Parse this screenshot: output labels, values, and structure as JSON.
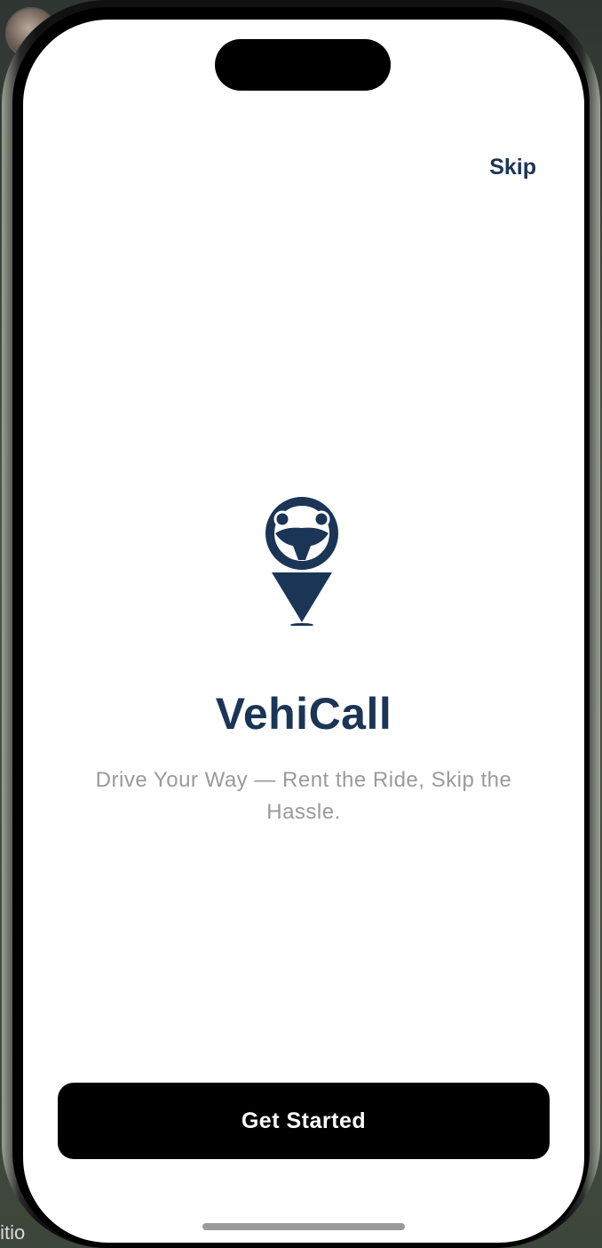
{
  "app": {
    "name": "VehiCall",
    "tagline": "Drive Your Way — Rent the Ride, Skip the Hassle."
  },
  "header": {
    "skip_label": "Skip"
  },
  "footer": {
    "cta_label": "Get Started"
  },
  "background": {
    "partial_label": "ıitio"
  },
  "colors": {
    "brand_navy": "#1b3556",
    "tagline_gray": "#9a9a9a",
    "cta_background": "#000000",
    "cta_text": "#ffffff"
  },
  "icons": {
    "logo": "steering-wheel-location-pin-icon"
  }
}
